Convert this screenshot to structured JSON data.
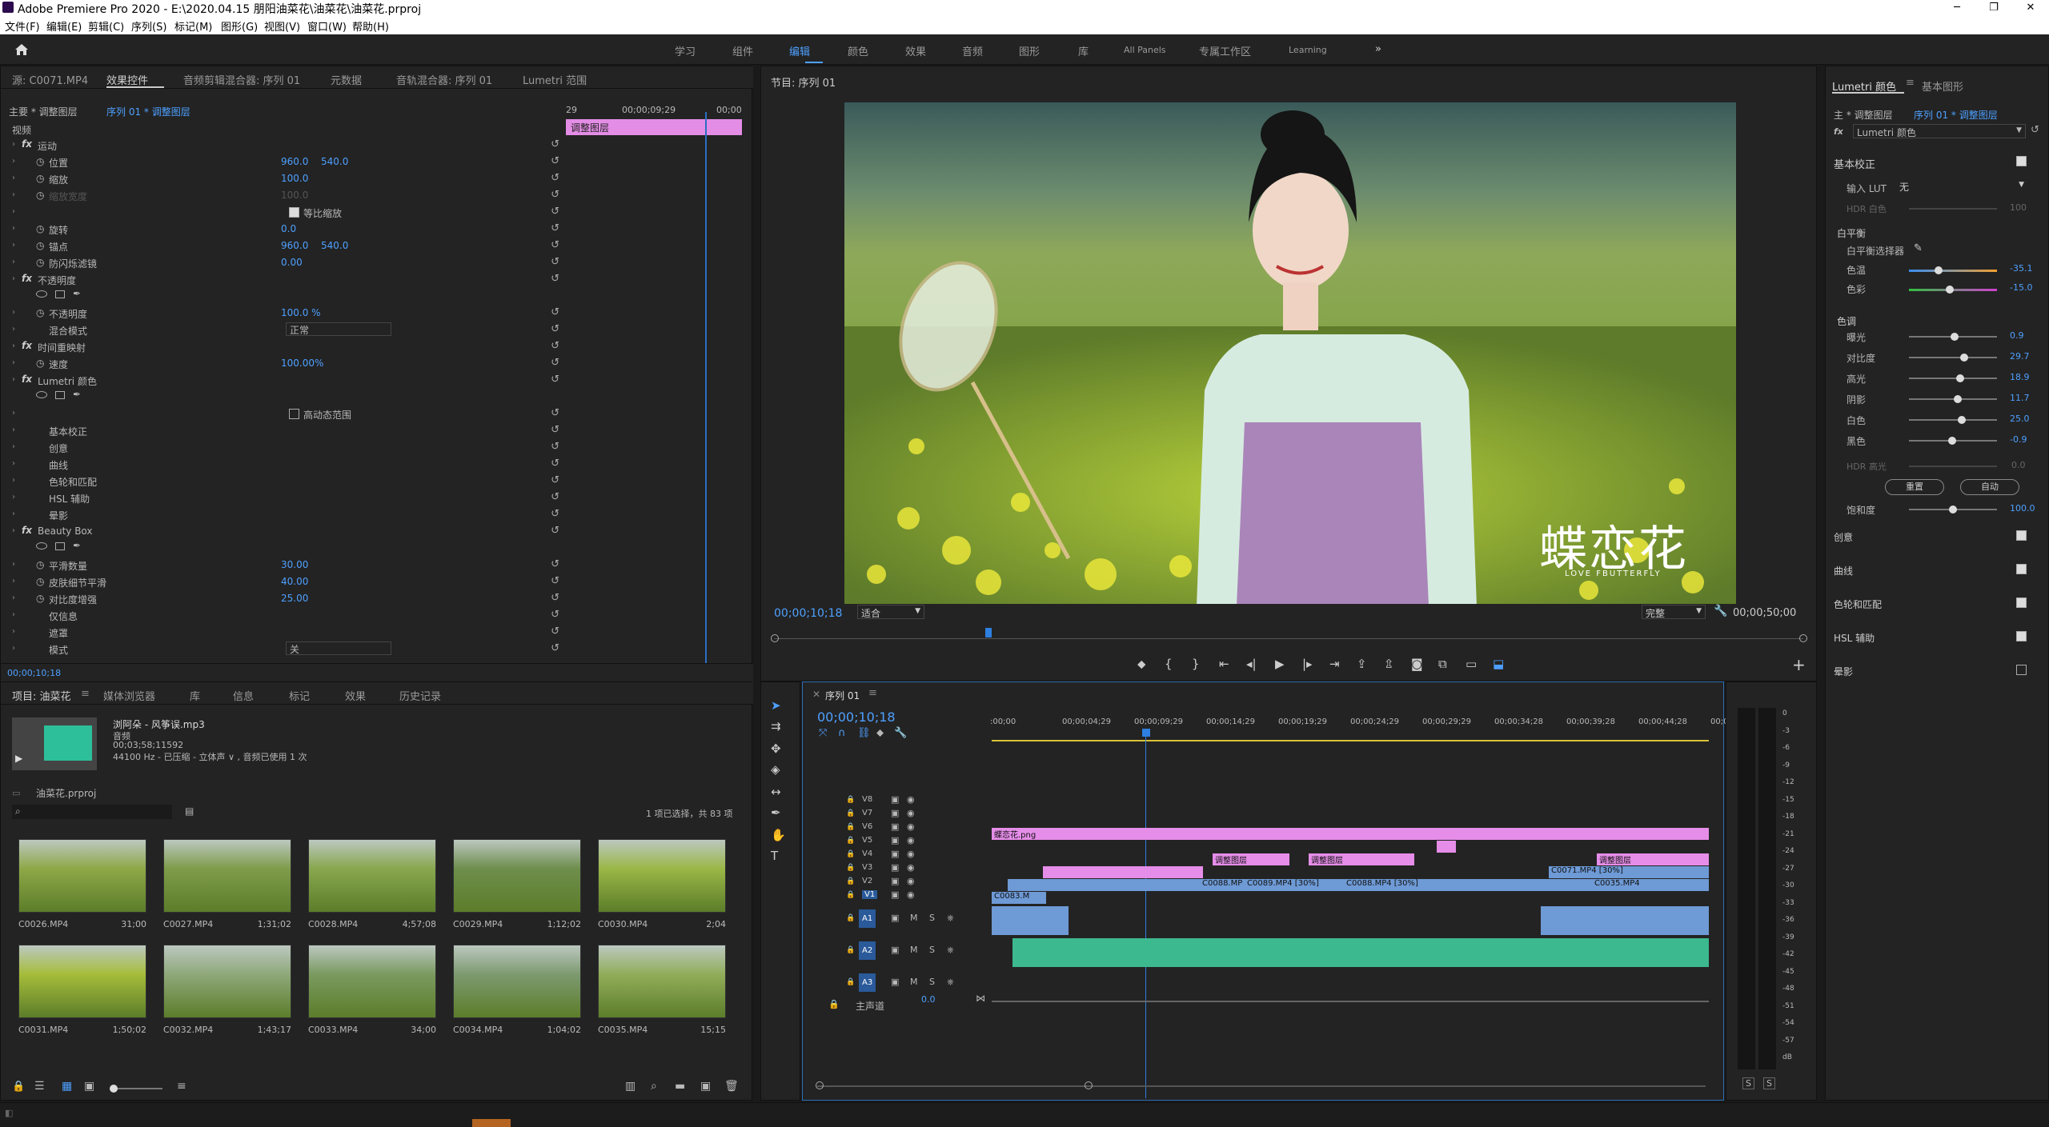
{
  "window": {
    "title": "Adobe Premiere Pro 2020 - E:\\2020.04.15  朋阳油菜花\\油菜花\\油菜花.prproj",
    "minimize": "─",
    "maximize": "❐",
    "close": "✕"
  },
  "menu": [
    "文件(F)",
    "编辑(E)",
    "剪辑(C)",
    "序列(S)",
    "标记(M)",
    "图形(G)",
    "视图(V)",
    "窗口(W)",
    "帮助(H)"
  ],
  "workspaces": [
    "学习",
    "组件",
    "编辑",
    "颜色",
    "效果",
    "音频",
    "图形",
    "库",
    "All Panels",
    "专属工作区",
    "Learning"
  ],
  "workspace_active": "编辑",
  "source_panel": {
    "tabs": [
      "源: C0071.MP4",
      "效果控件",
      "音频剪辑混合器: 序列 01",
      "元数据",
      "音轨混合器: 序列 01",
      "Lumetri 范围"
    ],
    "master": "主要 * 调整图层",
    "seq": "序列 01 * 调整图层",
    "tc_start": "29",
    "tc_mid": "00;00;09;29",
    "tc_end": "00;00",
    "clip_label": "调整图层",
    "section_video": "视频",
    "timecode": "00;00;10;18"
  },
  "effects": [
    {
      "name": "运动",
      "fx": true
    },
    {
      "name": "位置",
      "v1": "960.0",
      "v2": "540.0"
    },
    {
      "name": "缩放",
      "v1": "100.0"
    },
    {
      "name": "缩放宽度",
      "v1": "100.0",
      "dim": true
    },
    {
      "name": "等比缩放",
      "check": true
    },
    {
      "name": "旋转",
      "v1": "0.0"
    },
    {
      "name": "锚点",
      "v1": "960.0",
      "v2": "540.0"
    },
    {
      "name": "防闪烁滤镜",
      "v1": "0.00"
    },
    {
      "name": "不透明度",
      "fx": true
    },
    {
      "name": "不透明度",
      "v1": "100.0 %"
    },
    {
      "name": "混合模式",
      "dropdown": "正常"
    },
    {
      "name": "时间重映射",
      "fx": true
    },
    {
      "name": "速度",
      "v1": "100.00%"
    },
    {
      "name": "Lumetri 颜色",
      "fx": true
    },
    {
      "name": "高动态范围",
      "check": false
    },
    {
      "name": "基本校正"
    },
    {
      "name": "创意"
    },
    {
      "name": "曲线"
    },
    {
      "name": "色轮和匹配"
    },
    {
      "name": "HSL 辅助"
    },
    {
      "name": "晕影"
    },
    {
      "name": "Beauty Box",
      "fx": true
    },
    {
      "name": "平滑数量",
      "v1": "30.00"
    },
    {
      "name": "皮肤细节平滑",
      "v1": "40.00"
    },
    {
      "name": "对比度增强",
      "v1": "25.00"
    },
    {
      "name": "仅信息"
    },
    {
      "name": "遮罩"
    },
    {
      "name": "模式",
      "dropdown": "关"
    }
  ],
  "program": {
    "title": "节目: 序列 01",
    "timecode": "00;00;10;18",
    "fit": "适合",
    "quality": "完整",
    "duration": "00;00;50;00",
    "watermark_main": "蝶恋花",
    "watermark_sub": "LOVE FBUTTERFLY"
  },
  "project": {
    "tabs": [
      "项目: 油菜花",
      "媒体浏览器",
      "库",
      "信息",
      "标记",
      "效果",
      "历史记录"
    ],
    "preview_name": "浏阿朵 - 风筝误.mp3",
    "preview_type": "音频",
    "preview_dur": "00;03;58;11592",
    "preview_fmt": "44100 Hz - 已压缩 - 立体声 ∨ , 音频已使用 1 次",
    "proj_file": "油菜花.prproj",
    "selection": "1 项已选择，共 83 项",
    "items": [
      {
        "name": "C0026.MP4",
        "dur": "31;00"
      },
      {
        "name": "C0027.MP4",
        "dur": "1;31;02"
      },
      {
        "name": "C0028.MP4",
        "dur": "4;57;08"
      },
      {
        "name": "C0029.MP4",
        "dur": "1;12;02"
      },
      {
        "name": "C0030.MP4",
        "dur": "2;04"
      },
      {
        "name": "C0031.MP4",
        "dur": "1;50;02"
      },
      {
        "name": "C0032.MP4",
        "dur": "1;43;17"
      },
      {
        "name": "C0033.MP4",
        "dur": "34;00"
      },
      {
        "name": "C0034.MP4",
        "dur": "1;04;02"
      },
      {
        "name": "C0035.MP4",
        "dur": "15;15"
      }
    ]
  },
  "timeline": {
    "tab": "序列 01",
    "timecode": "00;00;10;18",
    "ticks": [
      ":00;00",
      "00;00;04;29",
      "00;00;09;29",
      "00;00;14;29",
      "00;00;19;29",
      "00;00;24;29",
      "00;00;29;29",
      "00;00;34;28",
      "00;00;39;28",
      "00;00;44;28",
      "00;0"
    ],
    "vtracks": [
      "V8",
      "V7",
      "V6",
      "V5",
      "V4",
      "V3",
      "V2",
      "V1"
    ],
    "atracks": [
      "A1",
      "A2",
      "A3"
    ],
    "master": "主声道",
    "master_val": "0.0",
    "clips": {
      "v6": "蝶恋花.png",
      "v4a": "调整图层",
      "v4b": "调整图层",
      "v4c": "调整图层",
      "v3": "C0071.MP4 [30%]",
      "v2a": "C0088.MP",
      "v2b": "C0089.MP4 [30%]",
      "v2c": "C0088.MP4 [30%]",
      "v2d": "C0035.MP4",
      "v1": "C0083.M"
    }
  },
  "meter": {
    "labels": [
      "0",
      "-3",
      "-6",
      "-9",
      "-12",
      "-15",
      "-18",
      "-21",
      "-24",
      "-27",
      "-30",
      "-33",
      "-36",
      "-39",
      "-42",
      "-45",
      "-48",
      "-51",
      "-54",
      "-57",
      "dB"
    ],
    "solo": "S"
  },
  "lumetri": {
    "tabs": [
      "Lumetri 颜色",
      "基本图形"
    ],
    "master": "主 * 调整图层",
    "seq": "序列 01 * 调整图层",
    "fx": "Lumetri 颜色",
    "basic": "基本校正",
    "lut_label": "输入 LUT",
    "lut_val": "无",
    "hdr_white": "HDR 白色",
    "hdr_white_val": "100",
    "wb": "白平衡",
    "wb_sel": "白平衡选择器",
    "temp": "色温",
    "temp_val": "-35.1",
    "tint": "色彩",
    "tint_val": "-15.0",
    "tone": "色调",
    "sliders": [
      {
        "name": "曝光",
        "val": "0.9",
        "pos": 0.52
      },
      {
        "name": "对比度",
        "val": "29.7",
        "pos": 0.63
      },
      {
        "name": "高光",
        "val": "18.9",
        "pos": 0.58
      },
      {
        "name": "阴影",
        "val": "11.7",
        "pos": 0.55
      },
      {
        "name": "白色",
        "val": "25.0",
        "pos": 0.6
      },
      {
        "name": "黑色",
        "val": "-0.9",
        "pos": 0.49
      }
    ],
    "hdr_spec": "HDR 高光",
    "hdr_spec_val": "0.0",
    "reset": "重置",
    "auto": "自动",
    "sat": "饱和度",
    "sat_val": "100.0",
    "sections": [
      "创意",
      "曲线",
      "色轮和匹配",
      "HSL 辅助",
      "晕影"
    ]
  }
}
